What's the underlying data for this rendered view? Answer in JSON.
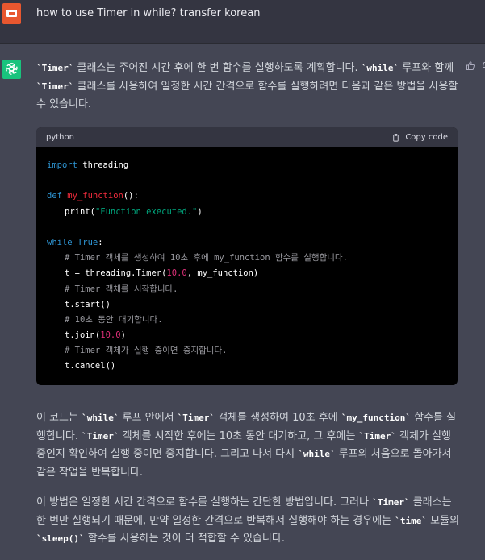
{
  "user": {
    "message": "how to use Timer in while? transfer korean"
  },
  "assistant": {
    "intro": [
      {
        "t": "code",
        "v": "`Timer`"
      },
      {
        "t": "text",
        "v": " 클래스는 주어진 시간 후에 한 번 함수를 실행하도록 계획합니다. "
      },
      {
        "t": "code",
        "v": "`while`"
      },
      {
        "t": "text",
        "v": " 루프와 함께 "
      },
      {
        "t": "code",
        "v": "`Timer`"
      },
      {
        "t": "text",
        "v": " 클래스를 사용하여 일정한 시간 간격으로 함수를 실행하려면 다음과 같은 방법을 사용할 수 있습니다."
      }
    ],
    "code_block": {
      "language": "python",
      "copy_label": "Copy code",
      "lines": [
        {
          "indent": 0,
          "parts": [
            {
              "c": "kw",
              "v": "import"
            },
            {
              "c": "",
              "v": " threading"
            }
          ]
        },
        {
          "indent": 0,
          "parts": []
        },
        {
          "indent": 0,
          "parts": [
            {
              "c": "kw",
              "v": "def"
            },
            {
              "c": "",
              "v": " "
            },
            {
              "c": "fn",
              "v": "my_function"
            },
            {
              "c": "",
              "v": "():"
            }
          ]
        },
        {
          "indent": 1,
          "parts": [
            {
              "c": "",
              "v": "print("
            },
            {
              "c": "str",
              "v": "\"Function executed.\""
            },
            {
              "c": "",
              "v": ")"
            }
          ]
        },
        {
          "indent": 0,
          "parts": []
        },
        {
          "indent": 0,
          "parts": [
            {
              "c": "kw",
              "v": "while"
            },
            {
              "c": "",
              "v": " "
            },
            {
              "c": "kw",
              "v": "True"
            },
            {
              "c": "",
              "v": ":"
            }
          ]
        },
        {
          "indent": 1,
          "parts": [
            {
              "c": "cm",
              "v": "# Timer 객체를 생성하여 10초 후에 my_function 함수를 실행합니다."
            }
          ]
        },
        {
          "indent": 1,
          "parts": [
            {
              "c": "",
              "v": "t = threading.Timer("
            },
            {
              "c": "num",
              "v": "10.0"
            },
            {
              "c": "",
              "v": ", my_function)"
            }
          ]
        },
        {
          "indent": 1,
          "parts": [
            {
              "c": "cm",
              "v": "# Timer 객체를 시작합니다."
            }
          ]
        },
        {
          "indent": 1,
          "parts": [
            {
              "c": "",
              "v": "t.start()"
            }
          ]
        },
        {
          "indent": 1,
          "parts": [
            {
              "c": "cm",
              "v": "# 10초 동안 대기합니다."
            }
          ]
        },
        {
          "indent": 1,
          "parts": [
            {
              "c": "",
              "v": "t.join("
            },
            {
              "c": "num",
              "v": "10.0"
            },
            {
              "c": "",
              "v": ")"
            }
          ]
        },
        {
          "indent": 1,
          "parts": [
            {
              "c": "cm",
              "v": "# Timer 객체가 실행 중이면 중지합니다."
            }
          ]
        },
        {
          "indent": 1,
          "parts": [
            {
              "c": "",
              "v": "t.cancel()"
            }
          ]
        }
      ]
    },
    "explanation": [
      {
        "t": "text",
        "v": "이 코드는 "
      },
      {
        "t": "code",
        "v": "`while`"
      },
      {
        "t": "text",
        "v": " 루프 안에서 "
      },
      {
        "t": "code",
        "v": "`Timer`"
      },
      {
        "t": "text",
        "v": " 객체를 생성하여 10초 후에 "
      },
      {
        "t": "code",
        "v": "`my_function`"
      },
      {
        "t": "text",
        "v": " 함수를 실행합니다. "
      },
      {
        "t": "code",
        "v": "`Timer`"
      },
      {
        "t": "text",
        "v": " 객체를 시작한 후에는 10초 동안 대기하고, 그 후에는 "
      },
      {
        "t": "code",
        "v": "`Timer`"
      },
      {
        "t": "text",
        "v": " 객체가 실행 중인지 확인하여 실행 중이면 중지합니다. 그리고 나서 다시 "
      },
      {
        "t": "code",
        "v": "`while`"
      },
      {
        "t": "text",
        "v": " 루프의 처음으로 돌아가서 같은 작업을 반복합니다."
      }
    ],
    "conclusion": [
      {
        "t": "text",
        "v": "이 방법은 일정한 시간 간격으로 함수를 실행하는 간단한 방법입니다. 그러나 "
      },
      {
        "t": "code",
        "v": "`Timer`"
      },
      {
        "t": "text",
        "v": " 클래스는 한 번만 실행되기 때문에, 만약 일정한 간격으로 반복해서 실행해야 하는 경우에는 "
      },
      {
        "t": "code",
        "v": "`time`"
      },
      {
        "t": "text",
        "v": " 모듈의 "
      },
      {
        "t": "code",
        "v": "`sleep()`"
      },
      {
        "t": "text",
        "v": " 함수를 사용하는 것이 더 적합할 수 있습니다."
      }
    ]
  },
  "icons": {
    "user_avatar": "user-avatar-icon",
    "assistant_avatar": "openai-logo-icon",
    "thumbs_up": "thumbs-up-icon",
    "thumbs_down": "thumbs-down-icon",
    "clipboard": "clipboard-icon"
  },
  "colors": {
    "bg_user": "#343541",
    "bg_assistant": "#444654",
    "code_bg": "#000000",
    "keyword": "#2e95d3",
    "function": "#f22c3d",
    "string": "#00a67d",
    "number": "#df3079",
    "comment": "#9a9aa0"
  }
}
